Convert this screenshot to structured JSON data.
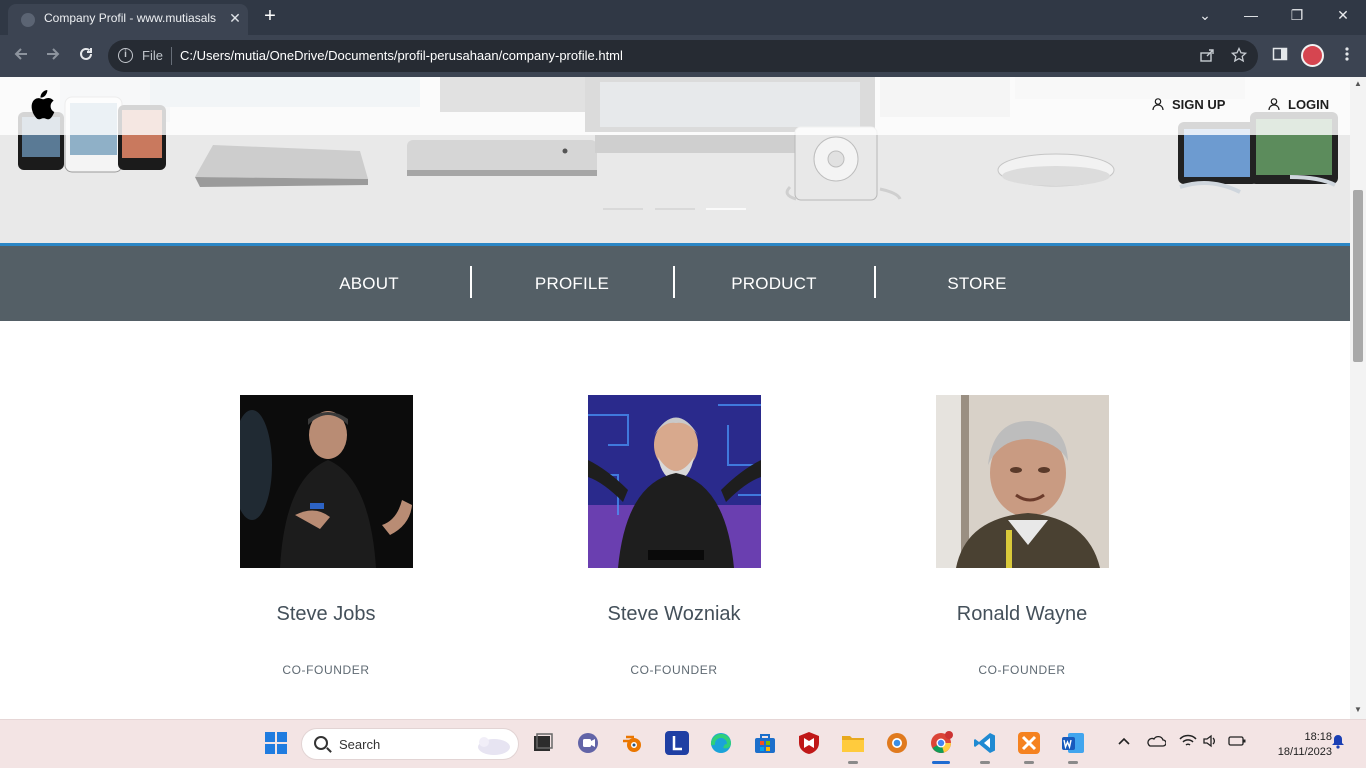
{
  "browser": {
    "tab_title": "Company Profil - www.mutiasals",
    "new_tab": "+",
    "close_tab": "✕",
    "address_prefix": "File",
    "url": "C:/Users/mutia/OneDrive/Documents/profil-perusahaan/company-profile.html",
    "window_controls": {
      "minimize": "—",
      "restore": "❐",
      "close": "✕",
      "tab_search": "⌄"
    }
  },
  "site": {
    "logo": "apple-logo",
    "top_links": [
      {
        "label": "SIGN UP",
        "icon": "user-icon"
      },
      {
        "label": "LOGIN",
        "icon": "user-icon"
      }
    ],
    "carousel": {
      "slide_count": 3,
      "active_index": 2
    },
    "menu": [
      "ABOUT",
      "PROFILE",
      "PRODUCT",
      "STORE"
    ],
    "team": [
      {
        "name": "Steve Jobs",
        "role": "CO-FOUNDER"
      },
      {
        "name": "Steve Wozniak",
        "role": "CO-FOUNDER"
      },
      {
        "name": "Ronald Wayne",
        "role": "CO-FOUNDER"
      }
    ],
    "colors": {
      "menu_bg": "#545f66",
      "accent_line": "#2b86c5"
    }
  },
  "taskbar": {
    "search_placeholder": "Search",
    "time": "18:18",
    "date": "18/11/2023"
  }
}
